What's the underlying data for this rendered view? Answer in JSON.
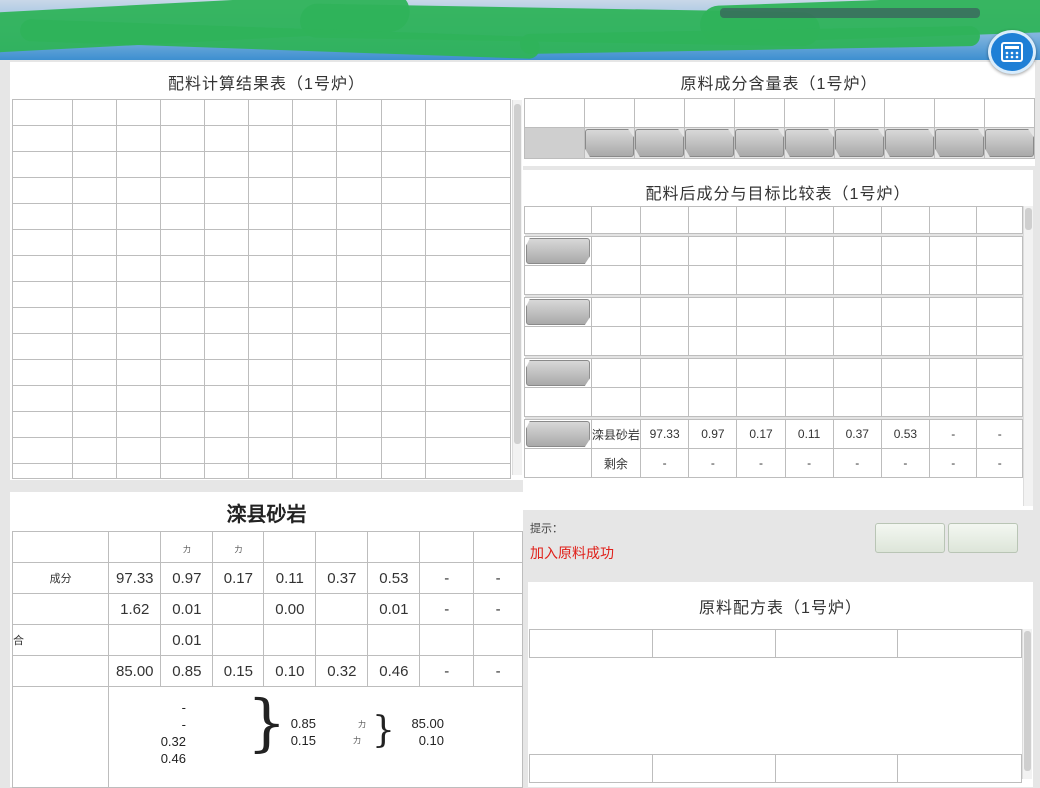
{
  "window": {
    "calc_icon": "calculator-icon"
  },
  "left_panel": {
    "title": "配料计算结果表（1号炉）"
  },
  "right_top_panel": {
    "title": "原料成分含量表（1号炉）"
  },
  "right_mid_panel": {
    "title": "配料后成分与目标比较表（1号炉）",
    "rows": [
      {
        "name": "滦县砂岩",
        "values": [
          "97.33",
          "0.97",
          "0.17",
          "0.11",
          "0.37",
          "0.53",
          "-",
          "-"
        ]
      },
      {
        "name": "剩余",
        "values": [
          "-",
          "-",
          "-",
          "-",
          "-",
          "-",
          "-",
          "-"
        ]
      }
    ]
  },
  "material_panel": {
    "title": "滦县砂岩",
    "rows": [
      {
        "label": "成分",
        "values": [
          "97.33",
          "0.97",
          "0.17",
          "0.11",
          "0.37",
          "0.53",
          "-",
          "-"
        ]
      },
      {
        "label": "",
        "values": [
          "1.62",
          "0.01",
          "",
          "0.00",
          "",
          "0.01",
          "-",
          "-"
        ]
      },
      {
        "label": "合",
        "values": [
          "",
          "0.01",
          "",
          "",
          "",
          "",
          "",
          ""
        ]
      },
      {
        "label": "",
        "values": [
          "85.00",
          "0.85",
          "0.15",
          "0.10",
          "0.32",
          "0.46",
          "-",
          "-"
        ]
      }
    ],
    "summary": {
      "left_stack": [
        "-",
        "-",
        "0.32",
        "0.46"
      ],
      "mid_stack": [
        "0.85",
        "0.15"
      ],
      "right_stack": [
        "85.00",
        "0.10"
      ]
    }
  },
  "status": {
    "hint": "提示：",
    "message": "加入原料成功"
  },
  "bottom_right_panel": {
    "title": "原料配方表（1号炉）"
  }
}
